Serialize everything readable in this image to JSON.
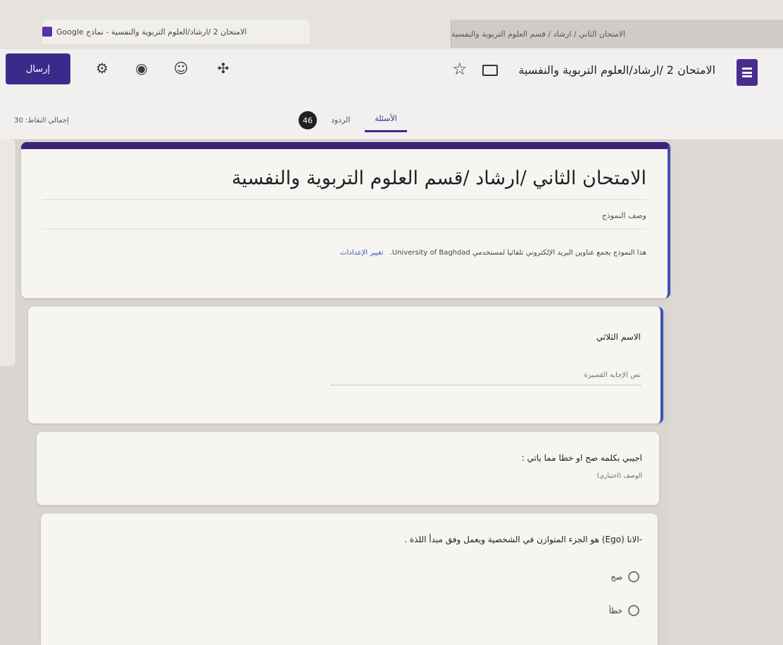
{
  "browser": {
    "active_tab_title": "الامتحان 2 /ارشاد/العلوم التربوية والنفسية - نماذج Google",
    "inactive_tab_title": "الامتحان الثاني / ارشاد / قسم العلوم التربوية والنفسية"
  },
  "header": {
    "send_label": "إرسال",
    "form_title": "الامتحان 2 /ارشاد/العلوم التربوية والنفسية",
    "icons": [
      "gear-icon",
      "eye-icon",
      "palette-icon",
      "addon-icon",
      "folder-icon",
      "star-icon",
      "forms-doc-icon"
    ]
  },
  "tabs": {
    "questions_label": "الأسئلة",
    "responses_label": "الردود",
    "responses_count": "46",
    "total_points": "إجمالي النقاط: 30"
  },
  "form": {
    "title": "الامتحان الثاني /ارشاد /قسم العلوم التربوية والنفسية",
    "description_placeholder": "وصف النموذج",
    "email_notice": "هذا النموذج يجمع عناوين البريد الإلكتروني تلقائيا لمستخدمي University of Baghdad.",
    "change_settings_link": "تغيير الإعدادات"
  },
  "questions": [
    {
      "title": "الاسم الثلاثي",
      "answer_hint": "نص الإجابة القصيرة"
    },
    {
      "title": "اجيبي بكلمه صح او خطا مما ياتي :",
      "description_hint": "الوصف (اختياري)"
    },
    {
      "text": "-الانا (Ego) هو الجزء المتوازن في الشخصية ويعمل وفق مبدأ اللذة .",
      "options": [
        "صح",
        "خطأ"
      ]
    }
  ],
  "colors": {
    "accent": "#3c2a8a",
    "card_border": "#3f51b5"
  }
}
